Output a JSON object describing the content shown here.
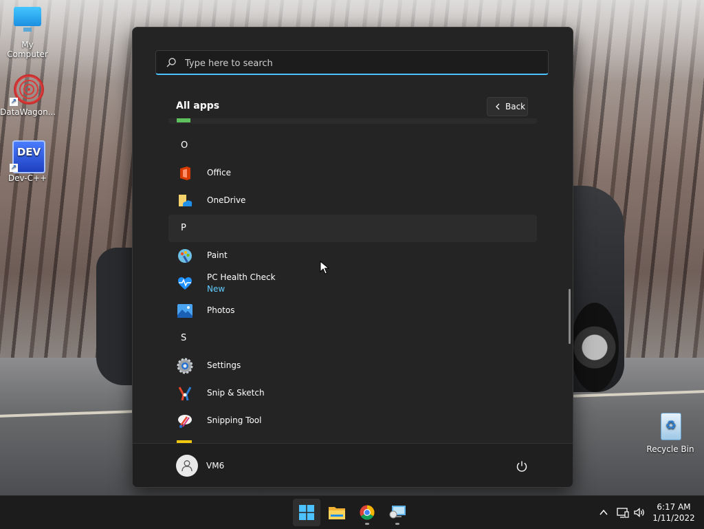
{
  "desktop": {
    "icons": [
      {
        "label": "My Computer"
      },
      {
        "label": "DataWagon..."
      },
      {
        "label": "Dev-C++",
        "glyph": "DEV"
      },
      {
        "label": "Recycle Bin"
      }
    ]
  },
  "start_menu": {
    "search": {
      "placeholder": "Type here to search",
      "value": ""
    },
    "header": {
      "title": "All apps",
      "back_label": "Back"
    },
    "groups": {
      "o": "O",
      "p": "P",
      "s": "S"
    },
    "apps": {
      "office": {
        "name": "Office",
        "icon": "office-icon"
      },
      "onedrive": {
        "name": "OneDrive",
        "icon": "onedrive-icon"
      },
      "paint": {
        "name": "Paint",
        "icon": "paint-icon"
      },
      "pc_health": {
        "name": "PC Health Check",
        "badge": "New",
        "icon": "pc-health-icon"
      },
      "photos": {
        "name": "Photos",
        "icon": "photos-icon"
      },
      "settings": {
        "name": "Settings",
        "icon": "settings-icon"
      },
      "snip_sketch": {
        "name": "Snip & Sketch",
        "icon": "snip-sketch-icon"
      },
      "snipping_tool": {
        "name": "Snipping Tool",
        "icon": "snipping-tool-icon"
      }
    },
    "footer": {
      "user": "VM6"
    }
  },
  "taskbar": {
    "apps": [
      "start-icon",
      "file-explorer-icon",
      "chrome-icon",
      "remote-desktop-icon"
    ],
    "clock": {
      "time": "6:17 AM",
      "date": "1/11/2022"
    }
  },
  "colors": {
    "accent": "#4cc2ff",
    "badge": "#60cdff",
    "menu_bg": "#242424"
  }
}
